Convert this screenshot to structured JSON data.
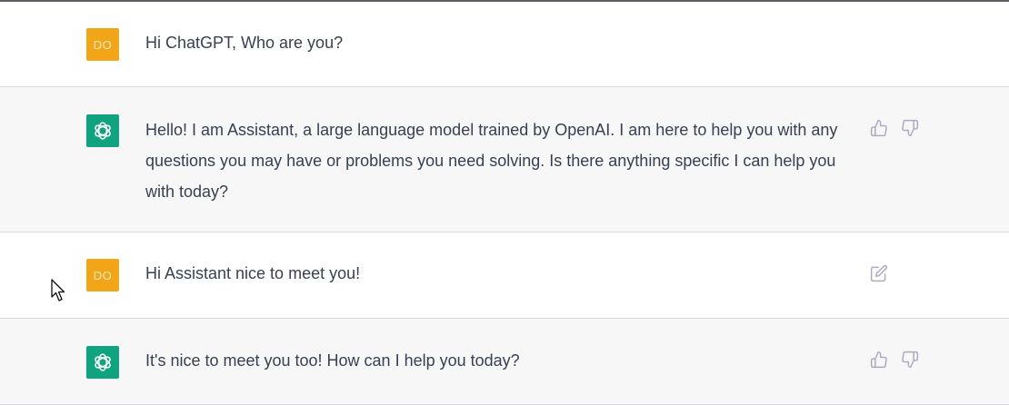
{
  "conversation": {
    "messages": [
      {
        "role": "user",
        "avatar_initials": "DO",
        "text": "Hi ChatGPT, Who are you?"
      },
      {
        "role": "assistant",
        "text": "Hello! I am Assistant, a large language model trained by OpenAI. I am here to help you with any questions you may have or problems you need solving. Is there anything specific I can help you with today?"
      },
      {
        "role": "user",
        "avatar_initials": "DO",
        "text": "Hi Assistant nice to meet you!"
      },
      {
        "role": "assistant",
        "text": "It's nice to meet you too! How can I help you today?"
      }
    ]
  },
  "colors": {
    "user_avatar": "#f2a516",
    "assistant_avatar": "#10a37f",
    "assistant_row_bg": "#f7f7f8",
    "text": "#374151",
    "icon": "#acacbe"
  },
  "icons": {
    "assistant_avatar": "openai-logo-icon",
    "like": "thumbs-up-icon",
    "dislike": "thumbs-down-icon",
    "edit": "edit-icon",
    "cursor": "mouse-pointer-icon"
  }
}
